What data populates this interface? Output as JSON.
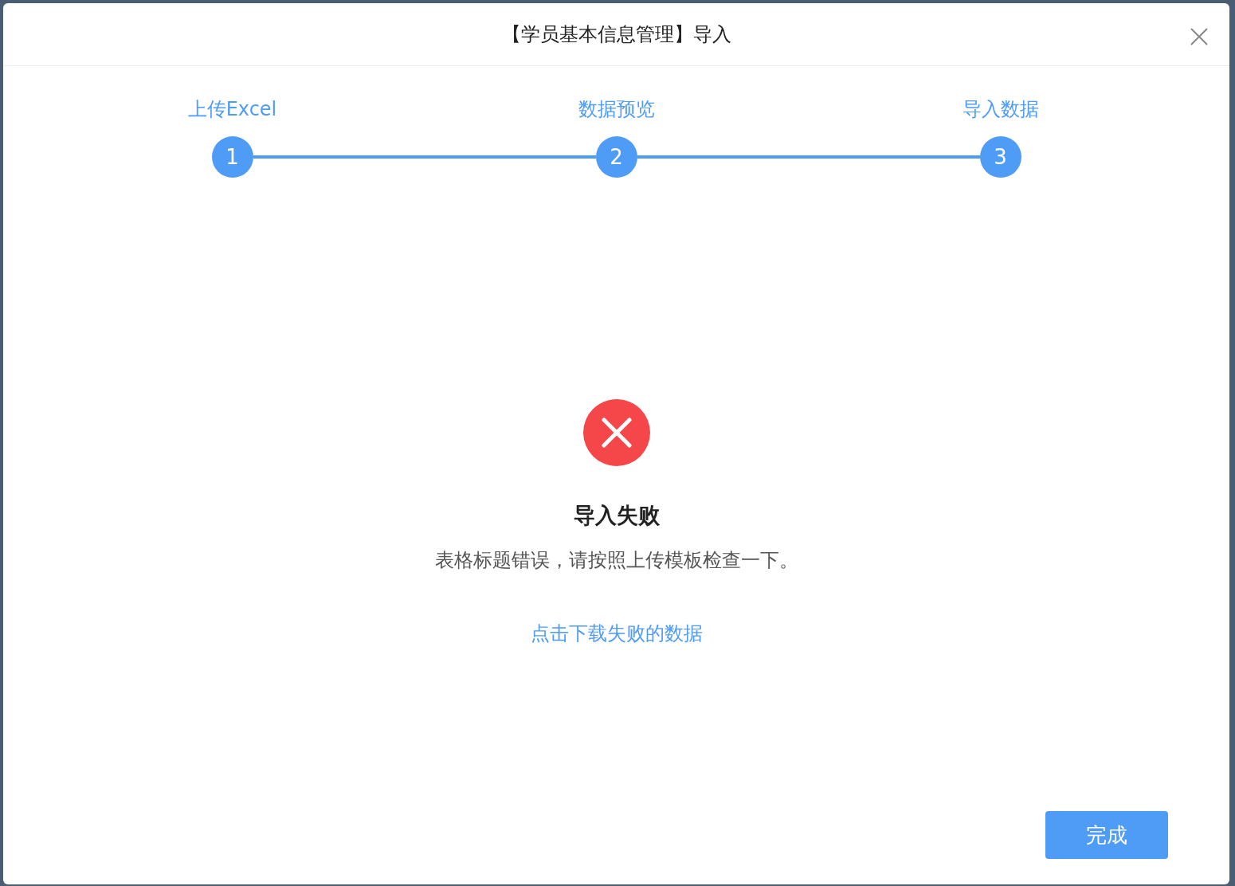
{
  "dialog": {
    "title": "【学员基本信息管理】导入"
  },
  "steps": [
    {
      "label": "上传Excel",
      "number": "1",
      "done": true
    },
    {
      "label": "数据预览",
      "number": "2",
      "done": true
    },
    {
      "label": "导入数据",
      "number": "3",
      "done": true
    }
  ],
  "result": {
    "kind": "error",
    "title": "导入失败",
    "message": "表格标题错误，请按照上传模板检查一下。",
    "link": "点击下载失败的数据"
  },
  "footer": {
    "button": "完成"
  }
}
